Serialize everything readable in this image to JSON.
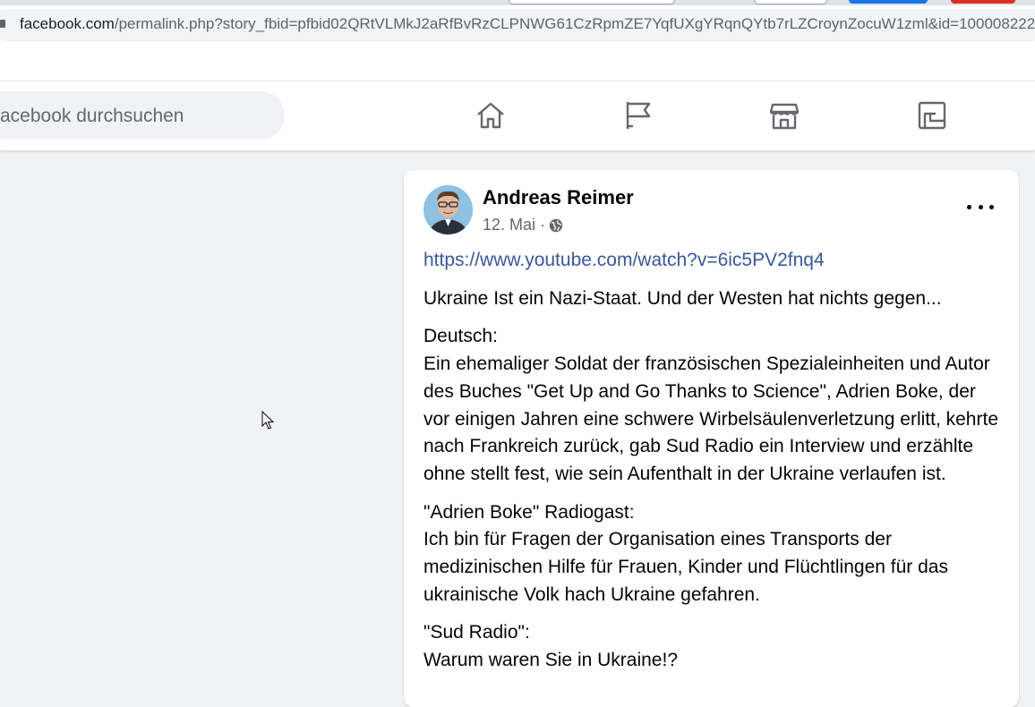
{
  "browser": {
    "url_host": "facebook.com",
    "url_path": "/permalink.php?story_fbid=pfbid02QRtVLMkJ2aRfBvRzCLPNWG61CzRpmZE7YqfUXgYRqnQYtb7rLZCroynZocuW1zml&id=100008222"
  },
  "nav": {
    "search_placeholder": "acebook durchsuchen",
    "icons": [
      "home-icon",
      "pages-flag-icon",
      "marketplace-icon",
      "gaming-icon"
    ]
  },
  "post": {
    "author": "Andreas Reimer",
    "date": "12. Mai · ",
    "link": "https://www.youtube.com/watch?v=6ic5PV2fnq4",
    "paragraphs": [
      "Ukraine Ist ein Nazi-Staat. Und der Westen hat nichts gegen...",
      "Deutsch:",
      "Ein ehemaliger Soldat der französischen Spezialeinheiten und Autor des Buches \"Get Up and Go Thanks to Science\", Adrien Boke, der vor einigen Jahren eine schwere Wirbelsäulenverletzung erlitt, kehrte nach Frankreich zurück, gab Sud Radio ein Interview und erzählte ohne stellt fest, wie sein Aufenthalt in der Ukraine verlaufen ist.",
      "\"Adrien Boke\" Radiogast:",
      "Ich bin für Fragen der Organisation eines Transports der medizinischen Hilfe für Frauen, Kinder und Flüchtlingen für das ukrainische Volk hach Ukraine gefahren.",
      "\"Sud Radio\":",
      "Warum waren Sie in Ukraine!?"
    ]
  },
  "colors": {
    "background": "#f0f2f5",
    "link": "#385898",
    "secondary_text": "#65676b"
  }
}
